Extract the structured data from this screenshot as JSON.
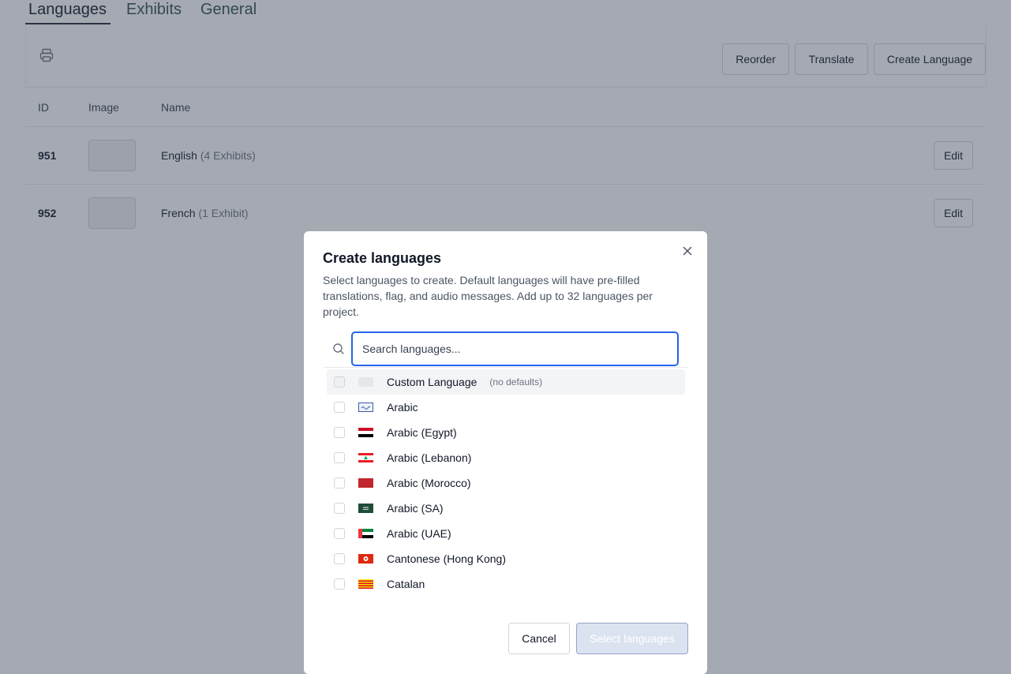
{
  "tabs": [
    {
      "label": "Languages",
      "active": true
    },
    {
      "label": "Exhibits",
      "active": false
    },
    {
      "label": "General",
      "active": false
    }
  ],
  "toolbar": {
    "print_icon": "printer-icon",
    "reorder_label": "Reorder",
    "translate_label": "Translate",
    "create_label": "Create Language"
  },
  "table": {
    "headers": {
      "id": "ID",
      "image": "Image",
      "name": "Name"
    },
    "rows": [
      {
        "id": "951",
        "name": "English",
        "count": "(4 Exhibits)",
        "action": "Edit"
      },
      {
        "id": "952",
        "name": "French",
        "count": "(1 Exhibit)",
        "action": "Edit"
      }
    ]
  },
  "modal": {
    "title": "Create languages",
    "description": "Select languages to create. Default languages will have pre-filled translations, flag, and audio messages. Add up to 32 languages per project.",
    "search": {
      "placeholder": "Search languages...",
      "value": ""
    },
    "languages": [
      {
        "label": "Custom Language",
        "note": "(no defaults)",
        "flag": "blank",
        "checked": false
      },
      {
        "label": "Arabic",
        "flag": "arabic",
        "checked": false
      },
      {
        "label": "Arabic (Egypt)",
        "flag": "egypt",
        "checked": false
      },
      {
        "label": "Arabic (Lebanon)",
        "flag": "lebanon",
        "checked": false
      },
      {
        "label": "Arabic (Morocco)",
        "flag": "morocco",
        "checked": false
      },
      {
        "label": "Arabic (SA)",
        "flag": "saudi",
        "checked": false
      },
      {
        "label": "Arabic (UAE)",
        "flag": "uae",
        "checked": false
      },
      {
        "label": "Cantonese (Hong Kong)",
        "flag": "hongkong",
        "checked": false
      },
      {
        "label": "Catalan",
        "flag": "catalan",
        "checked": false
      }
    ],
    "cancel_label": "Cancel",
    "submit_label": "Select languages"
  },
  "colors": {
    "accent": "#2563eb",
    "overlay": "#374151",
    "submit_disabled": "#dbe3f1"
  }
}
